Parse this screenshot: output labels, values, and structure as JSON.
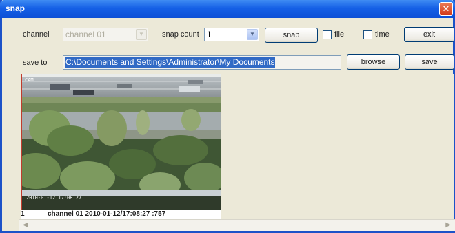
{
  "window": {
    "title": "snap",
    "close_glyph": "✕"
  },
  "channel": {
    "label": "channel",
    "value": "channel 01",
    "arrow_icon": "chevron-down-icon"
  },
  "snap_count": {
    "label": "snap count",
    "value": "1",
    "arrow_icon": "chevron-down-icon"
  },
  "buttons": {
    "snap": "snap",
    "exit": "exit",
    "browse": "browse",
    "save": "save"
  },
  "checkboxes": {
    "file": "file",
    "time": "time"
  },
  "save_to": {
    "label": "save to",
    "path": "C:\\Documents and Settings\\Administrator\\My Documents"
  },
  "preview": {
    "osd_text": "2010-01-12 17:08:27",
    "index": "1",
    "caption": "channel 01   2010-01-12/17:08:27 :757"
  },
  "scrollbar": {
    "left_icon": "chevron-left-icon",
    "right_icon": "chevron-right-icon"
  },
  "colors": {
    "titlebar": "#1560e6",
    "selection": "#316ac5",
    "window_bg": "#ece9d8",
    "close": "#d2391a"
  }
}
